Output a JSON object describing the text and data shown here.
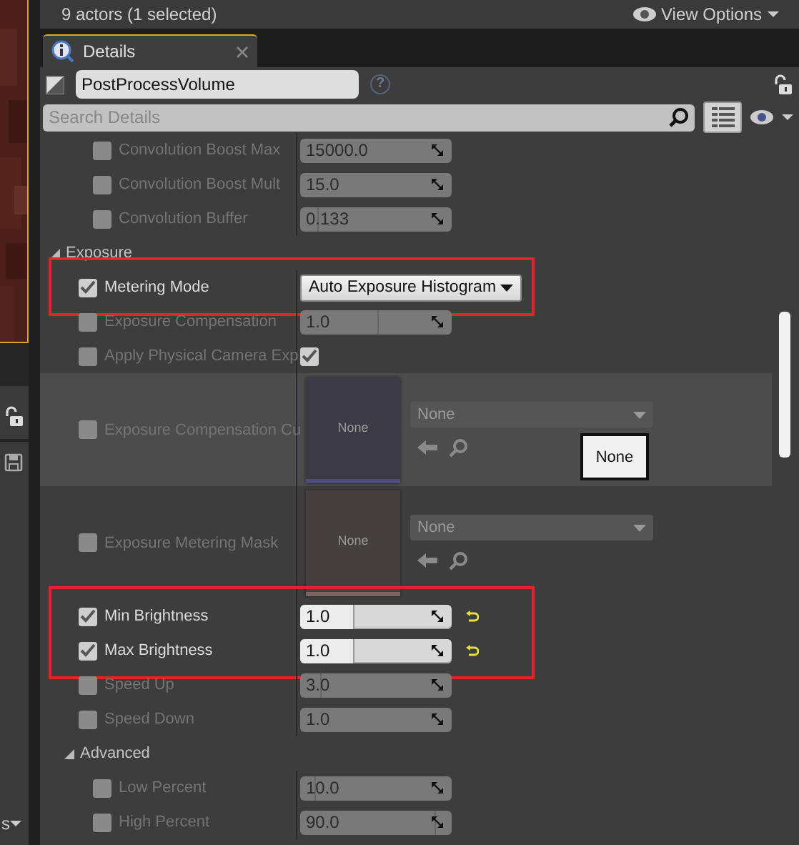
{
  "viewport_toolbar": {
    "actor_count": "9 actors (1 selected)",
    "view_options": "View Options"
  },
  "left_panel": {
    "label": "s"
  },
  "tab": {
    "label": "Details",
    "selected": true
  },
  "object_name": "PostProcessVolume",
  "help": "?",
  "search": {
    "placeholder": "Search Details"
  },
  "properties": [
    {
      "kind": "group",
      "children": [
        {
          "kind": "group",
          "children": [
            {
              "kind": "number",
              "label": "Convolution Boost Max",
              "checked": false,
              "value": "15000.0",
              "highlighted": false,
              "hovered": false,
              "reset": false
            },
            {
              "kind": "number",
              "label": "Convolution Boost Mult",
              "checked": false,
              "value": "15.0",
              "highlighted": false,
              "hovered": false,
              "reset": false
            },
            {
              "kind": "number",
              "label": "Convolution Buffer",
              "checked": false,
              "value": "0.133",
              "level": 0.12,
              "highlighted": false,
              "hovered": false,
              "reset": false
            }
          ]
        }
      ]
    },
    {
      "kind": "category",
      "label": "Exposure",
      "expanded": true,
      "children": [
        {
          "kind": "dropdown",
          "label": "Metering Mode",
          "checked": true,
          "value": "Auto Exposure Histogram",
          "highlighted": true,
          "hovered": false,
          "reset": false
        },
        {
          "kind": "number",
          "label": "Exposure Compensation",
          "checked": false,
          "value": "1.0",
          "level": 0.52,
          "highlighted": false,
          "hovered": false,
          "reset": false
        },
        {
          "kind": "bool",
          "label": "Apply Physical Camera Exp",
          "checked": false,
          "value_checked": true,
          "highlighted": false,
          "hovered": false,
          "reset": false
        },
        {
          "kind": "asset",
          "label": "Exposure Compensation Cu",
          "checked": false,
          "thumbnail_label": "None",
          "color": "#4f4b7c",
          "value": "None",
          "tooltip": "None",
          "highlighted": false,
          "hovered": true,
          "reset": false
        },
        {
          "kind": "asset",
          "label": "Exposure Metering Mask",
          "checked": false,
          "thumbnail_label": "None",
          "color": "#7d6361",
          "value": "None",
          "highlighted": false,
          "hovered": false,
          "reset": false
        },
        {
          "kind": "number",
          "label": "Min Brightness",
          "checked": true,
          "value": "1.0",
          "level": 0.36,
          "highlighted": true,
          "hovered": false,
          "reset": true
        },
        {
          "kind": "number",
          "label": "Max Brightness",
          "checked": true,
          "value": "1.0",
          "level": 0.36,
          "highlighted": true,
          "hovered": false,
          "reset": true
        },
        {
          "kind": "number",
          "label": "Speed Up",
          "checked": false,
          "value": "3.0",
          "level": 0.14,
          "highlighted": false,
          "hovered": false,
          "reset": false
        },
        {
          "kind": "number",
          "label": "Speed Down",
          "checked": false,
          "value": "1.0",
          "highlighted": false,
          "hovered": false,
          "reset": false
        },
        {
          "kind": "category",
          "label": "Advanced",
          "expanded": true,
          "children": [
            {
              "kind": "number",
              "label": "Low Percent",
              "checked": false,
              "value": "10.0",
              "level": 0.1,
              "highlighted": false,
              "hovered": false,
              "reset": false
            },
            {
              "kind": "number",
              "label": "High Percent",
              "checked": false,
              "value": "90.0",
              "level": 0.9,
              "highlighted": false,
              "hovered": false,
              "reset": false
            }
          ]
        }
      ]
    }
  ]
}
